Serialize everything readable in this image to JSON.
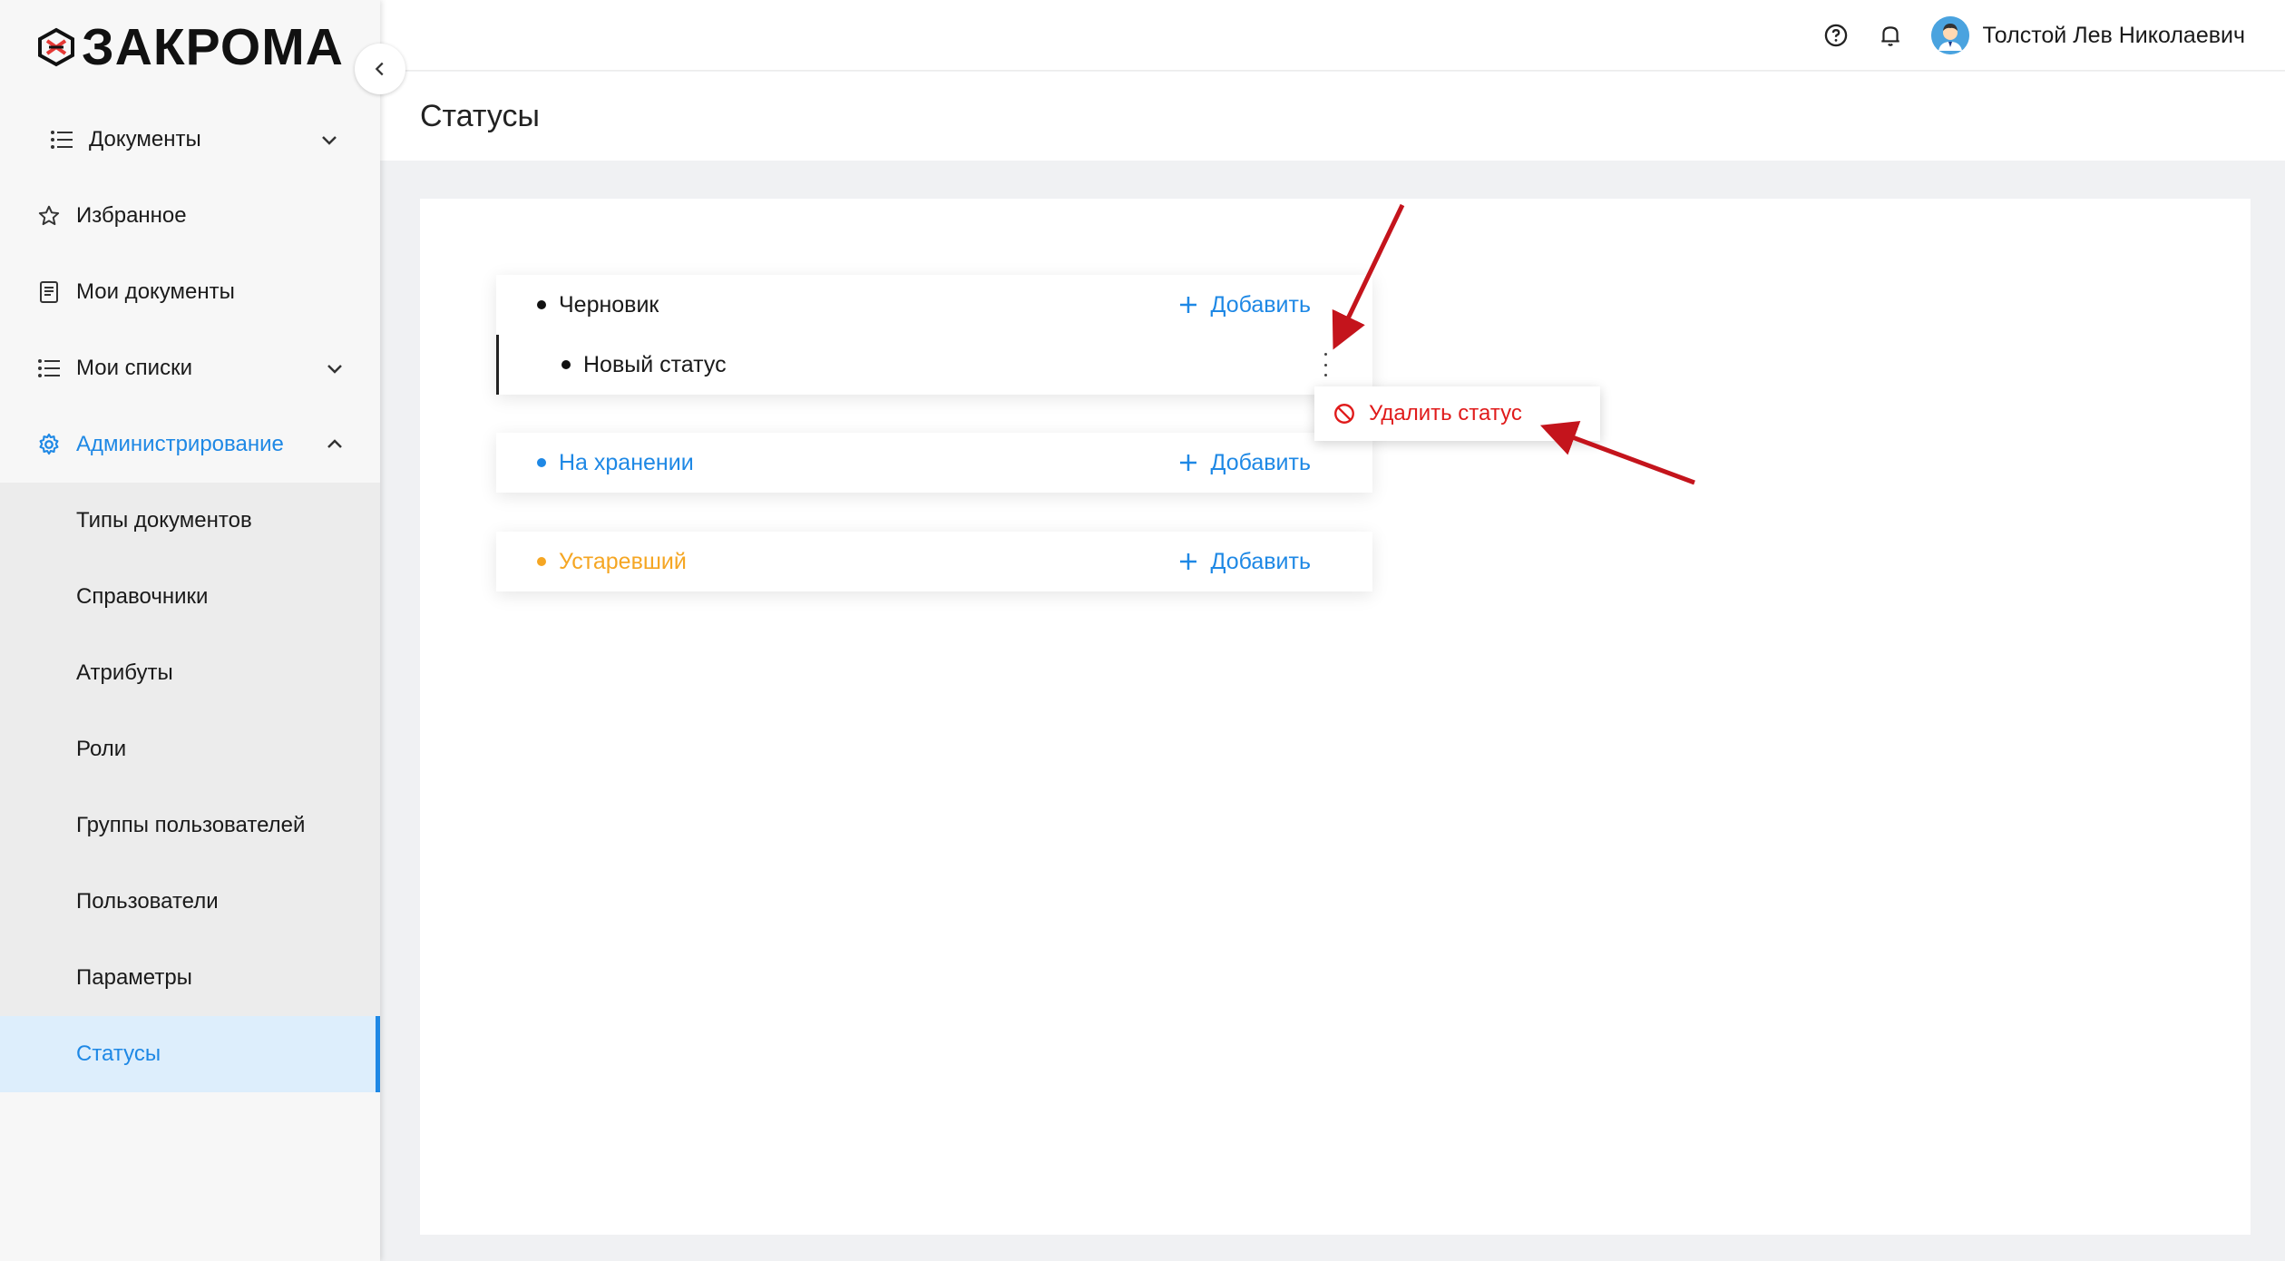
{
  "app": {
    "logo_text": "ЗАКРОМА"
  },
  "sidebar": {
    "items": [
      {
        "label": "Документы"
      },
      {
        "label": "Избранное"
      },
      {
        "label": "Мои документы"
      },
      {
        "label": "Мои списки"
      },
      {
        "label": "Администрирование"
      }
    ],
    "admin_sub": [
      {
        "label": "Типы документов"
      },
      {
        "label": "Справочники"
      },
      {
        "label": "Атрибуты"
      },
      {
        "label": "Роли"
      },
      {
        "label": "Группы пользователей"
      },
      {
        "label": "Пользователи"
      },
      {
        "label": "Параметры"
      },
      {
        "label": "Статусы"
      }
    ]
  },
  "header": {
    "user_name": "Толстой Лев Николаевич"
  },
  "page": {
    "title": "Статусы"
  },
  "statuses": [
    {
      "name": "Черновик",
      "color": "#111111",
      "add_label": "Добавить",
      "children": [
        {
          "name": "Новый статус"
        }
      ]
    },
    {
      "name": "На хранении",
      "color": "#1e88e5",
      "add_label": "Добавить"
    },
    {
      "name": "Устаревший",
      "color": "#f5a623",
      "add_label": "Добавить"
    }
  ],
  "context_menu": {
    "delete_label": "Удалить статус"
  },
  "colors": {
    "accent": "#1e88e5",
    "danger": "#e01b1b",
    "annotation": "#c4141c"
  }
}
